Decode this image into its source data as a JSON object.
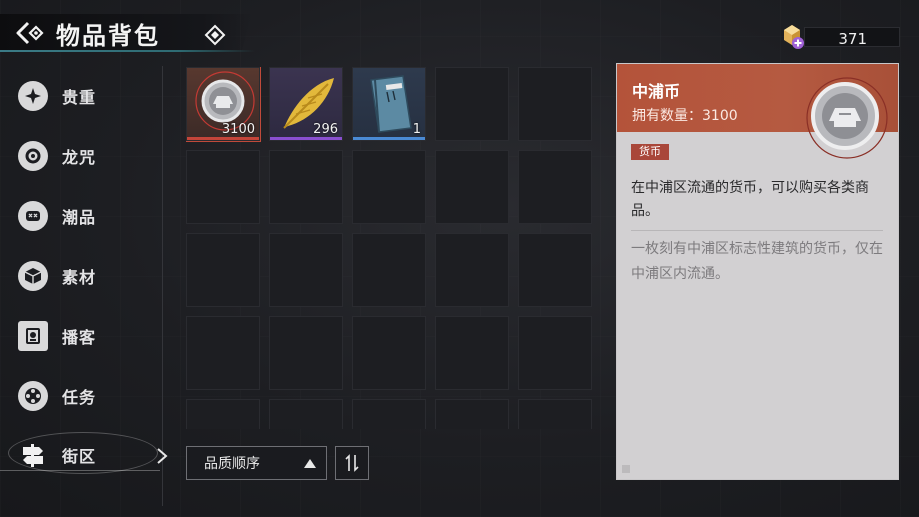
{
  "header": {
    "title": "物品背包"
  },
  "currency": {
    "value": "371",
    "icon": "premium-crystal-icon"
  },
  "sidebar": {
    "items": [
      {
        "label": "贵重",
        "icon": "star-badge-icon"
      },
      {
        "label": "龙咒",
        "icon": "ring-icon"
      },
      {
        "label": "潮品",
        "icon": "mask-icon"
      },
      {
        "label": "素材",
        "icon": "cube-icon"
      },
      {
        "label": "播客",
        "icon": "podcast-icon"
      },
      {
        "label": "任务",
        "icon": "film-reel-icon"
      },
      {
        "label": "街区",
        "icon": "street-sign-icon",
        "active": true
      }
    ]
  },
  "inventory": {
    "items": [
      {
        "count": "3100",
        "icon": "silver-coin-icon",
        "rarity_color": "#c4453a",
        "selected": true
      },
      {
        "count": "296",
        "icon": "golden-feather-icon",
        "rarity_color": "#8a4fd0"
      },
      {
        "count": "1",
        "icon": "blue-book-icon",
        "rarity_color": "#4a8ad4"
      }
    ]
  },
  "controls": {
    "sort_label": "品质顺序",
    "order_icon": "sort-order-icon"
  },
  "detail": {
    "name": "中浦币",
    "owned": "拥有数量：3100",
    "tag": "货币",
    "description": "在中浦区流通的货币，可以购买各类商品。",
    "flavor": "一枚刻有中浦区标志性建筑的货币，仅在中浦区内流通。"
  }
}
